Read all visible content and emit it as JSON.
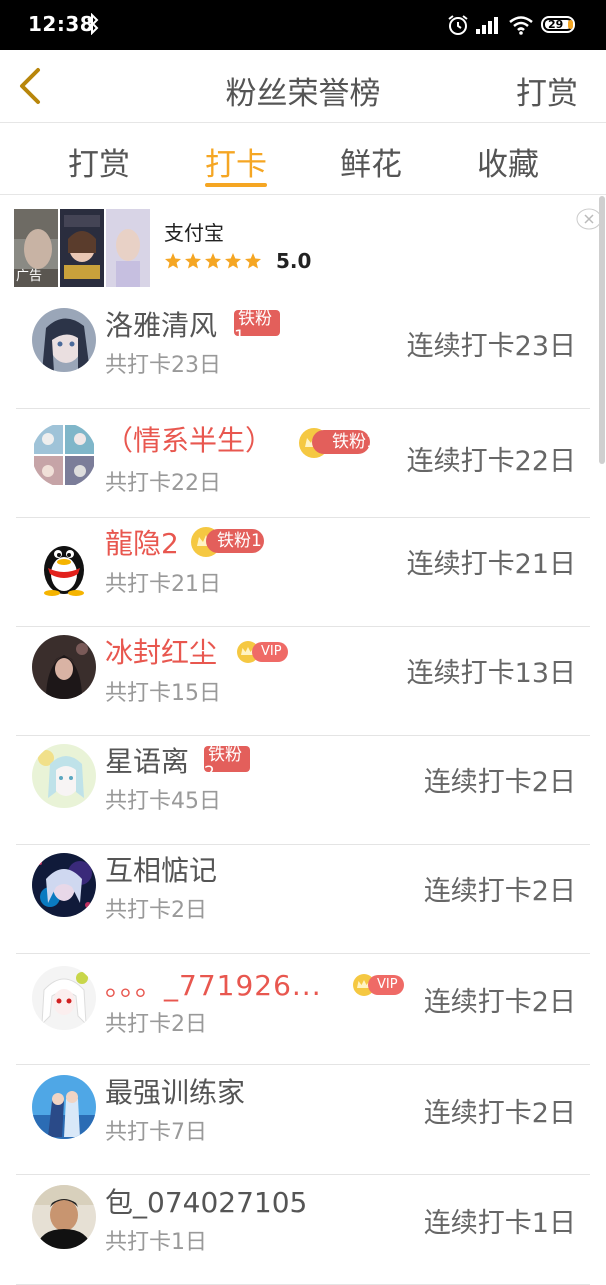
{
  "status_bar": {
    "time": "12:38",
    "battery": "29"
  },
  "nav": {
    "title": "粉丝荣誉榜",
    "action_label": "打赏"
  },
  "tabs": [
    {
      "label": "打赏",
      "active": false
    },
    {
      "label": "打卡",
      "active": true
    },
    {
      "label": "鲜花",
      "active": false
    },
    {
      "label": "收藏",
      "active": false
    }
  ],
  "ad": {
    "title": "支付宝",
    "rating": "5.0",
    "stars": 5,
    "label": "广告"
  },
  "list": [
    {
      "name": "洛雅清风",
      "badge": "铁粉1",
      "total": "共打卡23日",
      "streak": "连续打卡23日"
    },
    {
      "name": "（情系半生）",
      "badge": "铁粉1",
      "total": "共打卡22日",
      "streak": "连续打卡22日"
    },
    {
      "name": "龍隐2",
      "badge": "铁粉1",
      "total": "共打卡21日",
      "streak": "连续打卡21日"
    },
    {
      "name": "冰封红尘",
      "badge": "VIP",
      "total": "共打卡15日",
      "streak": "连续打卡13日"
    },
    {
      "name": "星语离",
      "badge": "铁粉2",
      "total": "共打卡45日",
      "streak": "连续打卡2日"
    },
    {
      "name": "互相惦记",
      "badge": "",
      "total": "共打卡2日",
      "streak": "连续打卡2日"
    },
    {
      "name": "。。。_771926...",
      "badge": "VIP",
      "total": "共打卡2日",
      "streak": "连续打卡2日"
    },
    {
      "name": "最强训练家",
      "badge": "",
      "total": "共打卡7日",
      "streak": "连续打卡2日"
    },
    {
      "name": "包_074027105",
      "badge": "",
      "total": "共打卡1日",
      "streak": "连续打卡1日"
    }
  ],
  "colors": {
    "accent": "#f5a623",
    "name_red": "#e8574f",
    "badge_red": "#e35f5b"
  }
}
